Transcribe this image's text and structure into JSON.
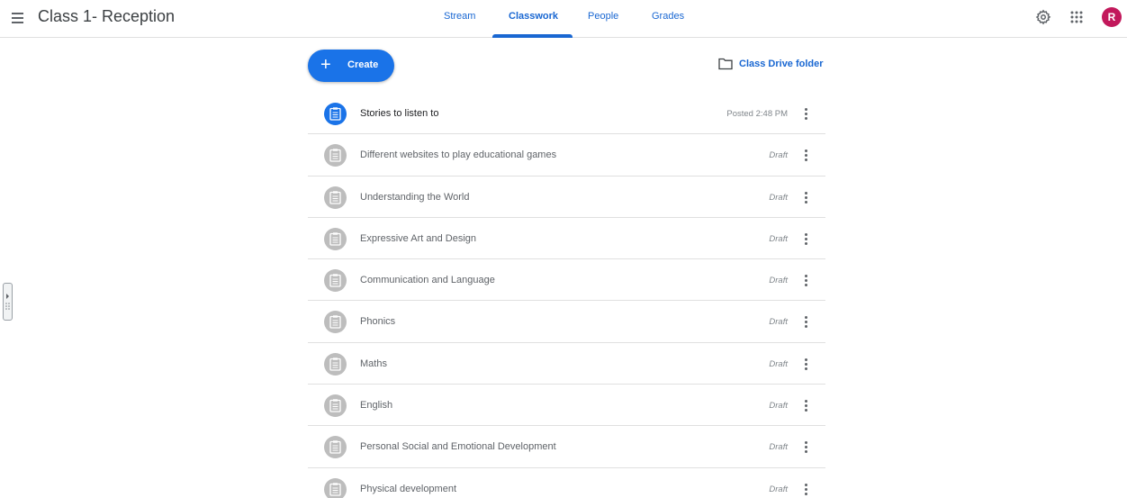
{
  "header": {
    "title": "Class 1- Reception",
    "tabs": [
      {
        "label": "Stream"
      },
      {
        "label": "Classwork",
        "active": true
      },
      {
        "label": "People"
      },
      {
        "label": "Grades"
      }
    ],
    "avatar_initial": "R",
    "icons": [
      "menu-icon",
      "settings-gear-icon",
      "apps-grid-icon"
    ]
  },
  "toolbar": {
    "create_label": "Create",
    "drive_label": "Class Drive folder"
  },
  "items": [
    {
      "title": "Stories to listen to",
      "status": "Posted 2:48 PM",
      "posted": true
    },
    {
      "title": "Different websites to play educational games",
      "status": "Draft"
    },
    {
      "title": "Understanding the World",
      "status": "Draft"
    },
    {
      "title": "Expressive Art and Design",
      "status": "Draft"
    },
    {
      "title": "Communication and Language",
      "status": "Draft"
    },
    {
      "title": "Phonics",
      "status": "Draft"
    },
    {
      "title": "Maths",
      "status": "Draft"
    },
    {
      "title": "English",
      "status": "Draft"
    },
    {
      "title": "Personal Social and Emotional Development",
      "status": "Draft"
    },
    {
      "title": "Physical development",
      "status": "Draft"
    }
  ],
  "colors": {
    "accent": "#1a73e8",
    "tab_text": "#1967d2",
    "avatar_bg": "#c2185b",
    "draft_icon": "#bdbdbd"
  }
}
